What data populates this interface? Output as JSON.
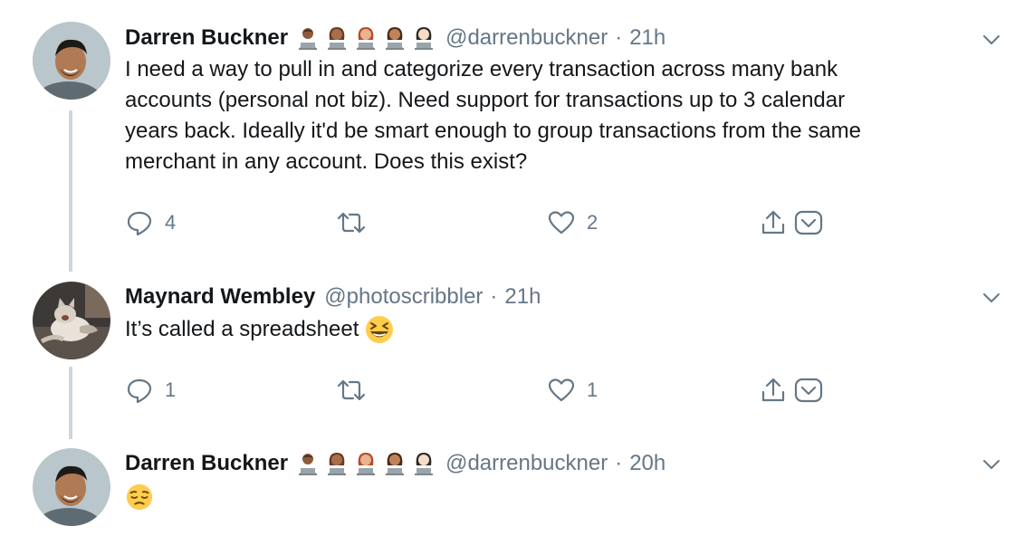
{
  "tweets": [
    {
      "name": "Darren Buckner",
      "handle": "@darrenbuckner",
      "separator": "·",
      "time": "21h",
      "text_lines": [
        "I need a way to pull in and categorize every transaction across many bank",
        "accounts (personal not biz). Need support for transactions up to 3 calendar",
        "years back. Ideally it'd be smart enough to group transactions from the same",
        "merchant in any account. Does this exist?"
      ],
      "reply_count": "4",
      "retweet_count": "",
      "like_count": "2"
    },
    {
      "name": "Maynard Wembley",
      "handle": "@photoscribbler",
      "separator": "·",
      "time": "21h",
      "text": "It’s called a spreadsheet",
      "text_emoji": "laughing-face-icon",
      "reply_count": "1",
      "retweet_count": "",
      "like_count": "1"
    },
    {
      "name": "Darren Buckner",
      "handle": "@darrenbuckner",
      "separator": "·",
      "time": "20h",
      "text_emoji": "pensive-face-icon"
    }
  ],
  "colors": {
    "text": "#14171a",
    "muted": "#657786",
    "thread_line": "#ccd6dd"
  },
  "icons": [
    "reply-icon",
    "retweet-icon",
    "like-icon",
    "share-icon",
    "dm-icon",
    "chevron-down-icon",
    "technologist-emoji-icon"
  ]
}
